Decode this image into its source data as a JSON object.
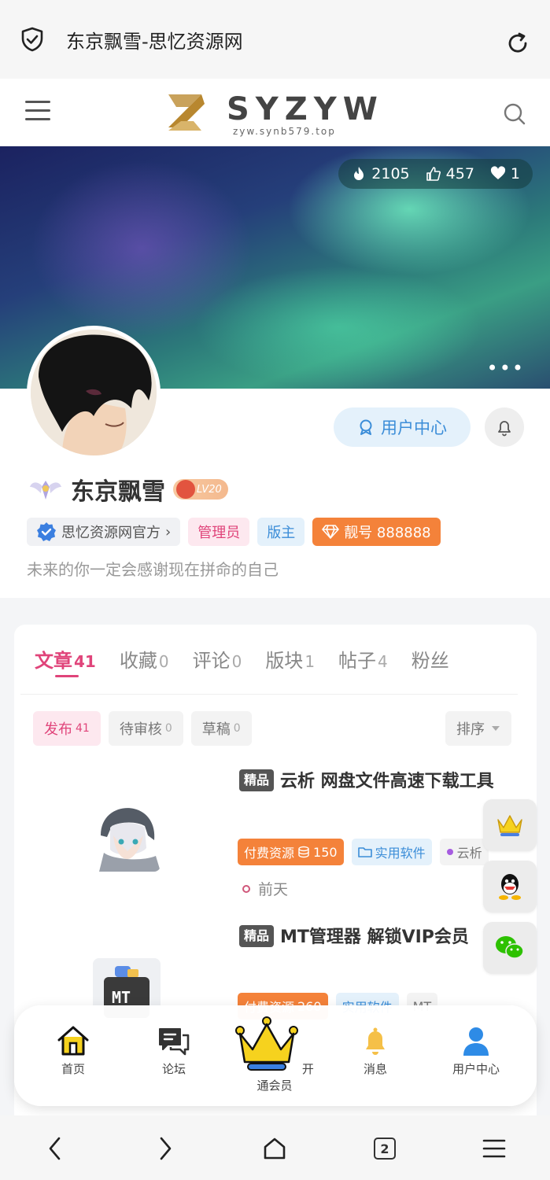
{
  "browser": {
    "page_title": "东京飘雪-思忆资源网",
    "tab_count": "2"
  },
  "site": {
    "logo_text": "SYZYW",
    "logo_sub": "zyw.synb579.top"
  },
  "cover": {
    "hot": "2105",
    "likes": "457",
    "favorites": "1",
    "more": "•••"
  },
  "profile": {
    "user_center_label": "用户中心",
    "username": "东京飘雪",
    "level": "LV20",
    "badges": {
      "official": "思忆资源网官方",
      "official_arrow": "›",
      "admin": "管理员",
      "moderator": "版主",
      "number": "靓号 888888"
    },
    "bio": "未来的你一定会感谢现在拼命的自己"
  },
  "tabs": [
    {
      "label": "文章",
      "count": "41"
    },
    {
      "label": "收藏",
      "count": "0"
    },
    {
      "label": "评论",
      "count": "0"
    },
    {
      "label": "版块",
      "count": "1"
    },
    {
      "label": "帖子",
      "count": "4"
    },
    {
      "label": "粉丝",
      "count": ""
    }
  ],
  "subtabs": [
    {
      "label": "发布",
      "count": "41"
    },
    {
      "label": "待审核",
      "count": "0"
    },
    {
      "label": "草稿",
      "count": "0"
    }
  ],
  "sort_label": "排序",
  "posts": [
    {
      "badge": "精品",
      "title": "云析 网盘文件高速下载工具",
      "paid_label": "付费资源",
      "price": "150",
      "category": "实用软件",
      "author_tag": "云析",
      "time": "前天"
    },
    {
      "badge": "精品",
      "title": "MT管理器 解锁VIP会员",
      "paid_label": "付费资源",
      "price": "260",
      "category": "实用软件",
      "author_tag": "MT"
    }
  ],
  "thumb2_text": "MT",
  "bottom_nav": {
    "home": "首页",
    "forum": "论坛",
    "vip": "开通会员",
    "messages": "消息",
    "user_center": "用户中心"
  },
  "colors": {
    "accent_pink": "#e0447a",
    "accent_blue": "#3b8dd8",
    "accent_orange": "#f4823a"
  }
}
